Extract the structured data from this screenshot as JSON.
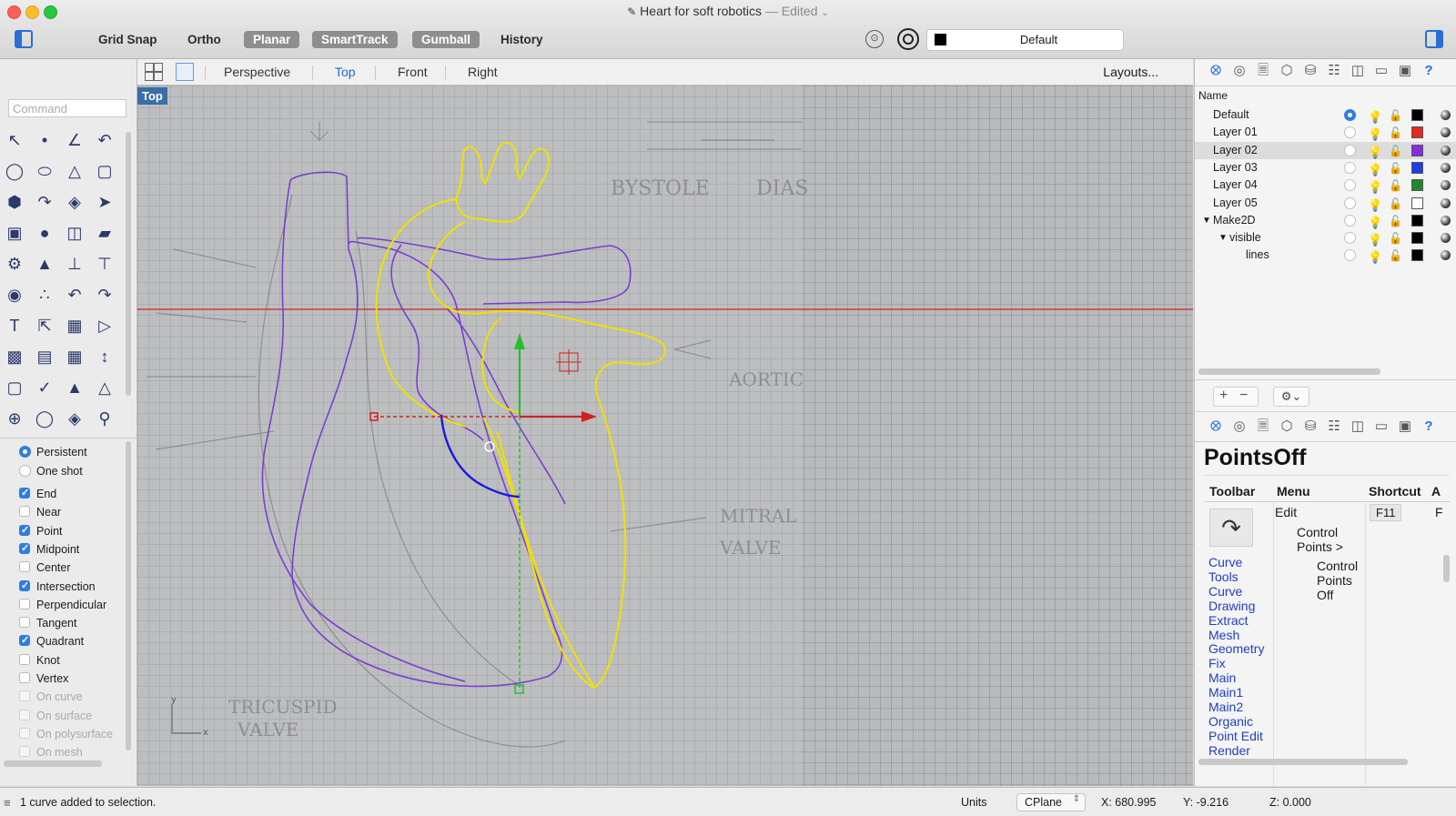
{
  "window": {
    "title": "Heart for soft robotics",
    "edited": " — Edited"
  },
  "toolbar": {
    "grid_snap": "Grid Snap",
    "ortho": "Ortho",
    "planar": "Planar",
    "smarttrack": "SmartTrack",
    "gumball": "Gumball",
    "history": "History",
    "current_layer": "Default"
  },
  "command": {
    "placeholder": "Command"
  },
  "osnaps": {
    "persistent": "Persistent",
    "one_shot": "One shot",
    "items": [
      {
        "label": "End",
        "checked": true,
        "enabled": true
      },
      {
        "label": "Near",
        "checked": false,
        "enabled": true
      },
      {
        "label": "Point",
        "checked": true,
        "enabled": true
      },
      {
        "label": "Midpoint",
        "checked": true,
        "enabled": true
      },
      {
        "label": "Center",
        "checked": false,
        "enabled": true
      },
      {
        "label": "Intersection",
        "checked": true,
        "enabled": true
      },
      {
        "label": "Perpendicular",
        "checked": false,
        "enabled": true
      },
      {
        "label": "Tangent",
        "checked": false,
        "enabled": true
      },
      {
        "label": "Quadrant",
        "checked": true,
        "enabled": true
      },
      {
        "label": "Knot",
        "checked": false,
        "enabled": true
      },
      {
        "label": "Vertex",
        "checked": false,
        "enabled": true
      },
      {
        "label": "On curve",
        "checked": false,
        "enabled": false
      },
      {
        "label": "On surface",
        "checked": false,
        "enabled": false
      },
      {
        "label": "On polysurface",
        "checked": false,
        "enabled": false
      },
      {
        "label": "On mesh",
        "checked": false,
        "enabled": false
      }
    ]
  },
  "viewports": {
    "tabs": [
      "Perspective",
      "Top",
      "Front",
      "Right"
    ],
    "active": "Top",
    "layouts": "Layouts...",
    "label": "Top"
  },
  "layers": {
    "header_name": "Name",
    "rows": [
      {
        "name": "Default",
        "current": true,
        "selected": false,
        "color": "#000000"
      },
      {
        "name": "Layer 01",
        "current": false,
        "selected": false,
        "color": "#e8281e"
      },
      {
        "name": "Layer 02",
        "current": false,
        "selected": true,
        "color": "#8a2be2"
      },
      {
        "name": "Layer 03",
        "current": false,
        "selected": false,
        "color": "#1f3fe0"
      },
      {
        "name": "Layer 04",
        "current": false,
        "selected": false,
        "color": "#1a8a2a"
      },
      {
        "name": "Layer 05",
        "current": false,
        "selected": false,
        "color": "#ffffff"
      },
      {
        "name": "Make2D",
        "current": false,
        "selected": false,
        "color": "#000000"
      },
      {
        "name": "visible",
        "current": false,
        "selected": false,
        "color": "#000000"
      },
      {
        "name": "lines",
        "current": false,
        "selected": false,
        "color": "#000000"
      }
    ]
  },
  "help": {
    "command_name": "PointsOff",
    "col_toolbar": "Toolbar",
    "col_menu": "Menu",
    "col_shortcut": "Shortcut",
    "col_extra": "A",
    "menu_path": [
      "Edit",
      "Control Points >",
      "Control Points Off"
    ],
    "shortcut": "F11",
    "extra_value": "F",
    "toolbar_links": [
      "Curve",
      "Tools",
      "Curve",
      "Drawing",
      "Extract",
      "Mesh",
      "Geometry",
      "Fix",
      "Main",
      "Main1",
      "Main2",
      "Organic",
      "Point Edit",
      "Render"
    ]
  },
  "status": {
    "message": "1 curve added to selection.",
    "units": "Units",
    "cplane": "CPlane",
    "x": "X: 680.995",
    "y": "Y: -9.216",
    "z": "Z: 0.000"
  },
  "colors": {
    "accent": "#2f7de1",
    "curve_yellow": "#f0e100",
    "curve_purple": "#7a3fd0",
    "curve_blue": "#1a1ae0",
    "axis_red": "#d02020",
    "axis_green": "#20c030"
  },
  "icons": {
    "layers_tab": "layers-icon",
    "properties_tab": "properties-icon",
    "help_tab": "help-icon"
  }
}
